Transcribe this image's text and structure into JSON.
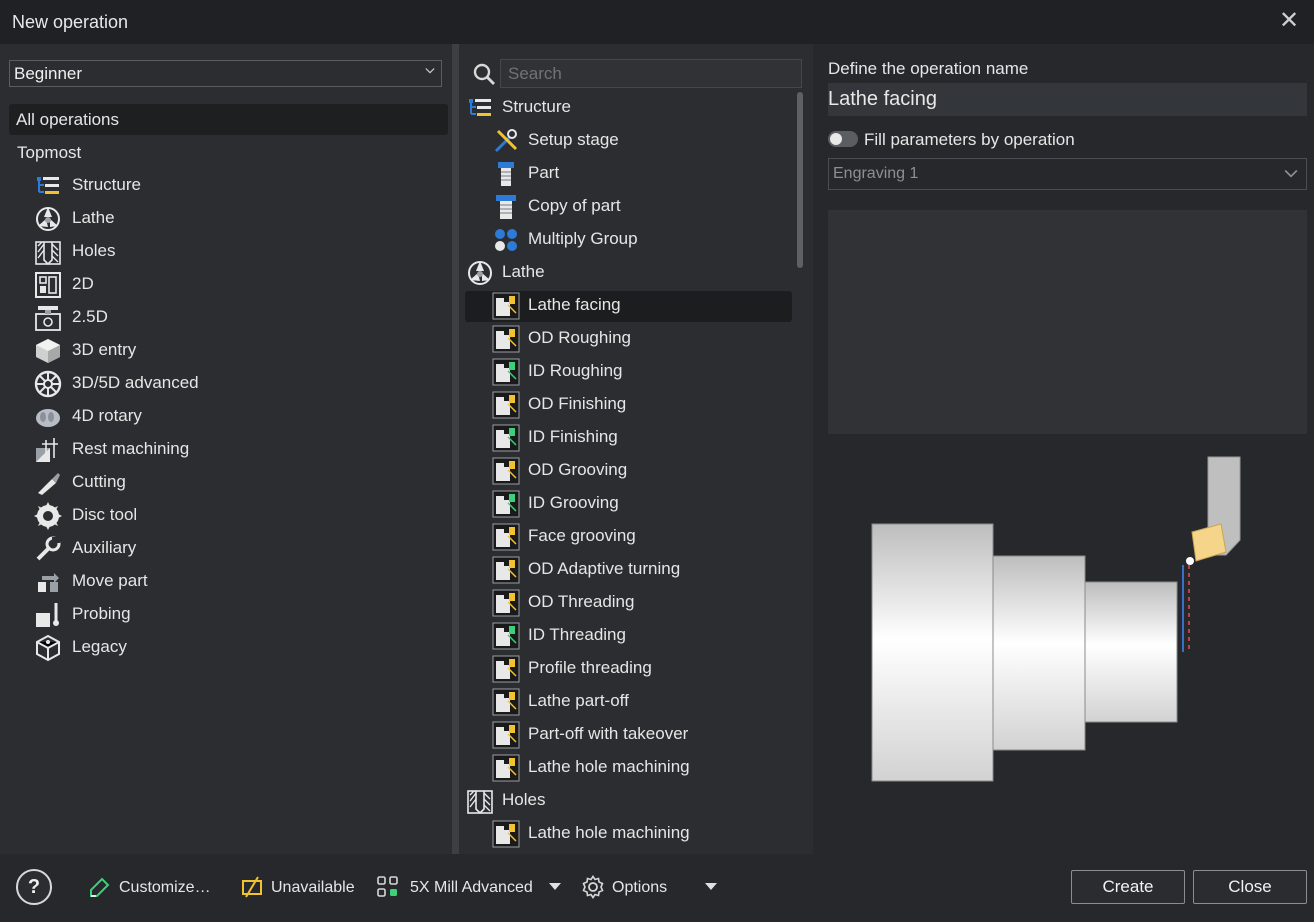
{
  "window": {
    "title": "New operation"
  },
  "left": {
    "level_select": "Beginner",
    "all_ops": "All operations",
    "topmost": "Topmost",
    "items": [
      {
        "label": "Structure",
        "icon": "structure-icon"
      },
      {
        "label": "Lathe",
        "icon": "lathe-icon"
      },
      {
        "label": "Holes",
        "icon": "holes-icon"
      },
      {
        "label": "2D",
        "icon": "2d-icon"
      },
      {
        "label": "2.5D",
        "icon": "2-5d-icon"
      },
      {
        "label": "3D entry",
        "icon": "3d-entry-icon"
      },
      {
        "label": "3D/5D advanced",
        "icon": "3d-5d-advanced-icon"
      },
      {
        "label": "4D rotary",
        "icon": "4d-rotary-icon"
      },
      {
        "label": "Rest machining",
        "icon": "rest-machining-icon"
      },
      {
        "label": "Cutting",
        "icon": "cutting-icon"
      },
      {
        "label": "Disc tool",
        "icon": "disc-tool-icon"
      },
      {
        "label": "Auxiliary",
        "icon": "auxiliary-icon"
      },
      {
        "label": "Move part",
        "icon": "move-part-icon"
      },
      {
        "label": "Probing",
        "icon": "probing-icon"
      },
      {
        "label": "Legacy",
        "icon": "legacy-icon"
      }
    ]
  },
  "middle": {
    "search_placeholder": "Search",
    "groups": [
      {
        "label": "Structure",
        "icon": "structure-icon",
        "items": [
          {
            "label": "Setup stage",
            "icon": "setup-stage-icon"
          },
          {
            "label": "Part",
            "icon": "part-icon"
          },
          {
            "label": "Copy of part",
            "icon": "copy-of-part-icon"
          },
          {
            "label": "Multiply Group",
            "icon": "multiply-group-icon"
          }
        ]
      },
      {
        "label": "Lathe",
        "icon": "lathe-icon",
        "items": [
          {
            "label": "Lathe facing",
            "icon": "lathe-facing-icon",
            "selected": true
          },
          {
            "label": "OD Roughing",
            "icon": "od-roughing-icon"
          },
          {
            "label": "ID Roughing",
            "icon": "id-roughing-icon"
          },
          {
            "label": "OD Finishing",
            "icon": "od-finishing-icon"
          },
          {
            "label": "ID Finishing",
            "icon": "id-finishing-icon"
          },
          {
            "label": "OD Grooving",
            "icon": "od-grooving-icon"
          },
          {
            "label": "ID Grooving",
            "icon": "id-grooving-icon"
          },
          {
            "label": "Face grooving",
            "icon": "face-grooving-icon"
          },
          {
            "label": "OD Adaptive turning",
            "icon": "od-adaptive-turning-icon"
          },
          {
            "label": "OD Threading",
            "icon": "od-threading-icon"
          },
          {
            "label": "ID Threading",
            "icon": "id-threading-icon"
          },
          {
            "label": "Profile threading",
            "icon": "profile-threading-icon"
          },
          {
            "label": "Lathe part-off",
            "icon": "lathe-part-off-icon"
          },
          {
            "label": "Part-off with takeover",
            "icon": "part-off-takeover-icon"
          },
          {
            "label": "Lathe hole machining",
            "icon": "lathe-hole-machining-icon"
          }
        ]
      },
      {
        "label": "Holes",
        "icon": "holes-icon",
        "items": [
          {
            "label": "Lathe hole machining",
            "icon": "lathe-hole-machining-icon"
          }
        ]
      }
    ]
  },
  "right": {
    "define_label": "Define the operation name",
    "op_name": "Lathe facing",
    "fill_label": "Fill parameters by operation",
    "fill_on": false,
    "fill_select": "Engraving 1"
  },
  "bottom": {
    "help": "?",
    "customize": "Customize…",
    "unavailable": "Unavailable",
    "machine": "5X Mill Advanced",
    "options": "Options",
    "create": "Create",
    "close": "Close"
  },
  "colors": {
    "accent_yellow": "#f2c230",
    "accent_blue": "#2d7bd6",
    "accent_green": "#3ecf7a"
  }
}
